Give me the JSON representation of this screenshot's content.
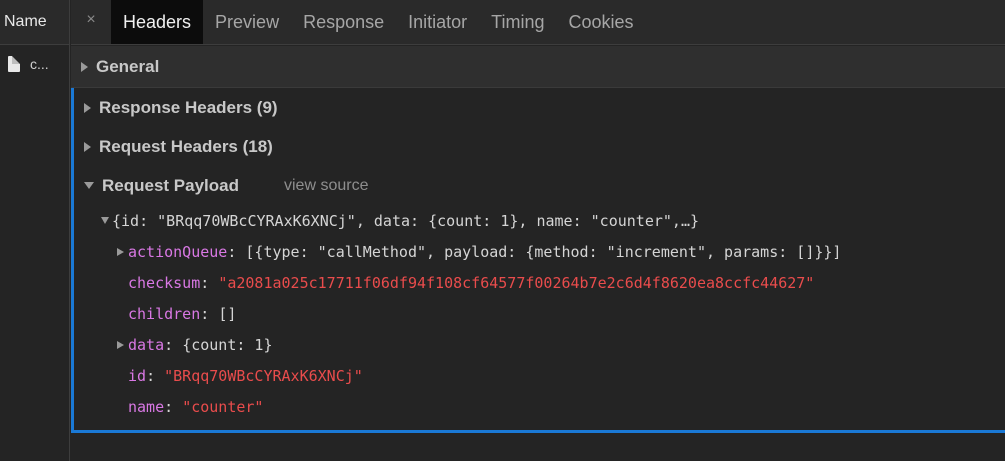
{
  "name_column": {
    "header": "Name",
    "rows": [
      {
        "label": "c..."
      }
    ]
  },
  "tabs": {
    "close_glyph": "×",
    "items": [
      {
        "label": "Headers",
        "active": true
      },
      {
        "label": "Preview"
      },
      {
        "label": "Response"
      },
      {
        "label": "Initiator"
      },
      {
        "label": "Timing"
      },
      {
        "label": "Cookies"
      }
    ]
  },
  "sections": {
    "general": "General",
    "response_headers": "Response Headers (9)",
    "request_headers": "Request Headers (18)",
    "request_payload": "Request Payload",
    "view_source": "view source"
  },
  "payload": {
    "root_summary": "{id: \"BRqq70WBcCYRAxK6XNCj\", data: {count: 1}, name: \"counter\",…}",
    "action_queue": {
      "key": "actionQueue",
      "value": "[{type: \"callMethod\", payload: {method: \"increment\", params: []}}]"
    },
    "checksum": {
      "key": "checksum",
      "value": "\"a2081a025c17711f06df94f108cf64577f00264b7e2c6d4f8620ea8ccfc44627\""
    },
    "children": {
      "key": "children",
      "value": "[]"
    },
    "data": {
      "key": "data",
      "value": "{count: 1}"
    },
    "id": {
      "key": "id",
      "value": "\"BRqq70WBcCYRAxK6XNCj\""
    },
    "name": {
      "key": "name",
      "value": "\"counter\""
    }
  },
  "colors": {
    "accent": "#1a79d6",
    "key": "#d978e4",
    "string": "#e94c4c"
  }
}
